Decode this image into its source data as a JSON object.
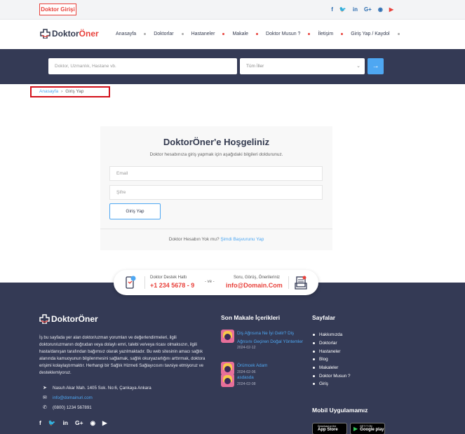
{
  "topbar": {
    "login_label": "Doktor Girişi",
    "social_icons": [
      "facebook-icon",
      "twitter-icon",
      "linkedin-icon",
      "google-plus-icon",
      "rss-icon",
      "youtube-icon"
    ]
  },
  "brand": {
    "name_part1": "Doktor",
    "name_part2": "Öner",
    "accent": "#e8413b",
    "dark": "#333a4f",
    "link": "#4ea7f2"
  },
  "nav": {
    "items": [
      "Anasayfa",
      "Doktorlar",
      "Hastaneler",
      "Makale",
      "Doktor Musun ?",
      "İletişim",
      "Giriş Yap / Kaydol"
    ]
  },
  "search": {
    "placeholder": "Doktor, Uzmanlık, Hastane vb.",
    "city_value": "Tüm İller"
  },
  "breadcrumb": {
    "home": "Anasayfa",
    "current": "Giriş Yap"
  },
  "login": {
    "title": "DoktorÖner'e Hoşgeliniz",
    "subtitle": "Doktor hesabınıza giriş yapmak için aşağıdaki bilgileri doldurunuz.",
    "email_placeholder": "Email",
    "password_placeholder": "Şifre",
    "submit_label": "Giriş Yap",
    "footer_text": "Doktor Hesabın Yok mu?",
    "apply_link": "Şimdi Başvurunu Yap"
  },
  "support": {
    "hotline_label": "Doktor Destek Hattı",
    "hotline_value": "+1 234 5678 - 9",
    "separator": "- ve -",
    "contact_label": "Soru, Görüş, Önerileriniz",
    "contact_value": "info@Domain.Com"
  },
  "footer": {
    "about": "İş bu sayfada yer alan doktor/uzman yorumları ve değerlendirmeleri, ilgili doktorun/uzmanın doğrudan veya dolaylı emri, talebi ve/veya ricası olmaksızın, ilgili hasta/danışan tarafından bağımsız olarak yazılmaktadır. Bu web sitesinin amacı sağlık alanında kamuoyunun bilgilenmesini sağlamak, sağlık okuryazarlığını arttırmak, doktora erişimi kolaylaştırmaktır. Herhangi bir Sağlık Hizmeti Sağlayıcısını tavsiye etmiyoruz ve desteklemiyoruz.",
    "address": "Nasuh Akar Mah. 1405 Sok. No:6, Çankaya Ankara",
    "email": "info@domainuri.com",
    "phone": "(0800) 1234 567891",
    "articles_heading": "Son Makale İçerikleri",
    "articles": [
      {
        "title": "Diş Ağrısına Ne İyi Gelir? Diş Ağrısını Geçiren Doğal Yöntemler",
        "date": "2024-02-12"
      },
      {
        "title": "Örümcek Adam",
        "date": "2024-02-06"
      },
      {
        "title": "asdasda",
        "date": "2024-02-08"
      }
    ],
    "pages_heading": "Sayfalar",
    "pages": [
      "Hakkımızda",
      "Doktorlar",
      "Hastaneler",
      "Blog",
      "Makaleler",
      "Doktor Musun ?",
      "Giriş"
    ],
    "mobile_heading": "Mobil Uygulamamız",
    "app_store": {
      "small": "Download on the",
      "big": "App Store"
    },
    "google_play": {
      "small": "GET IT ON",
      "big": "Google play"
    }
  }
}
